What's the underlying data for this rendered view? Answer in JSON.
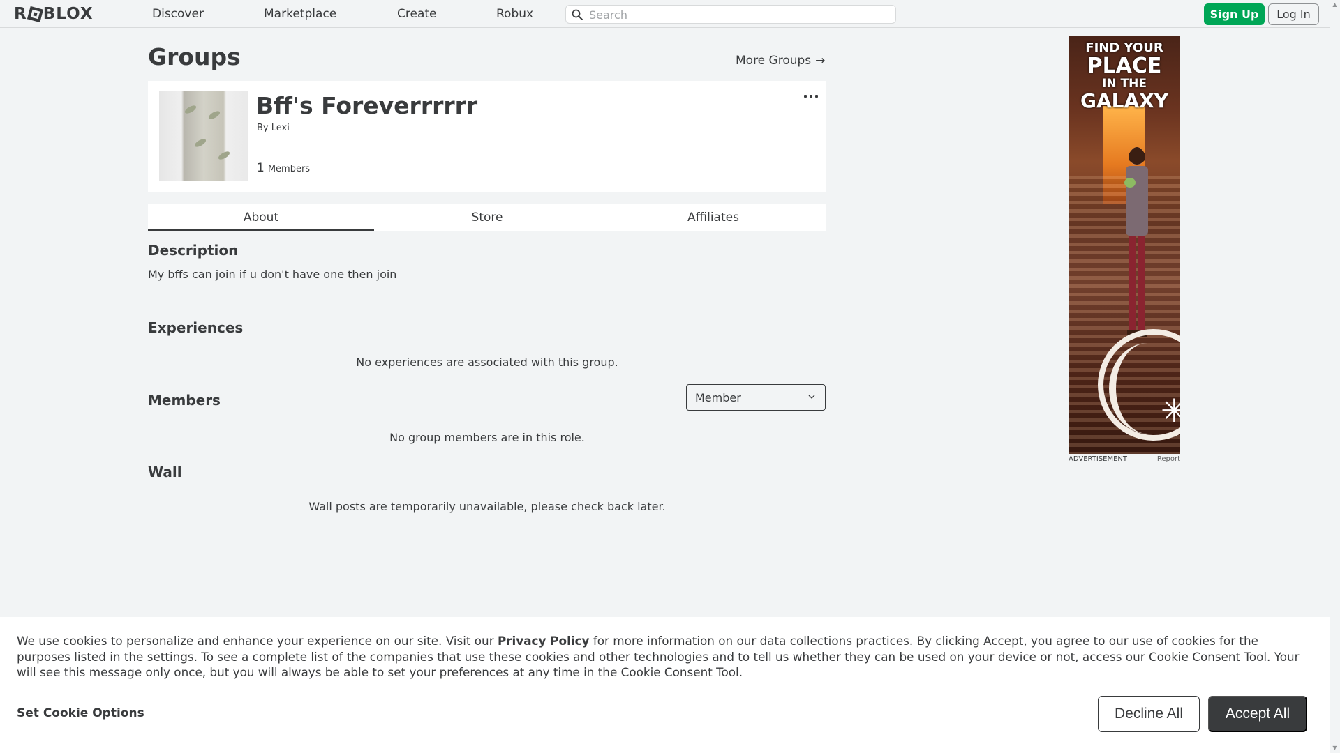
{
  "header": {
    "logo_text": "ROBLOX",
    "nav": [
      "Discover",
      "Marketplace",
      "Create",
      "Robux"
    ],
    "search_placeholder": "Search",
    "signup_label": "Sign Up",
    "login_label": "Log In"
  },
  "page": {
    "title": "Groups",
    "more_groups": "More Groups",
    "more_groups_icon": "arrow-right-icon"
  },
  "group": {
    "name": "Bff's Foreverrrrrr",
    "by_label": "By",
    "owner": "Lexi",
    "member_count": "1",
    "members_label": "Members",
    "more_icon": "ellipsis-icon"
  },
  "tabs": [
    {
      "label": "About",
      "active": true
    },
    {
      "label": "Store",
      "active": false
    },
    {
      "label": "Affiliates",
      "active": false
    }
  ],
  "about": {
    "description_heading": "Description",
    "description_text": "My bffs can join if u don't have one then join",
    "experiences_heading": "Experiences",
    "experiences_empty": "No experiences are associated with this group.",
    "members_heading": "Members",
    "role_select_value": "Member",
    "members_empty": "No group members are in this role.",
    "wall_heading": "Wall",
    "wall_empty": "Wall posts are temporarily unavailable, please check back later."
  },
  "ad": {
    "line1": "FIND YOUR",
    "line2": "PLACE",
    "line3": "IN THE",
    "line4": "GALAXY",
    "label": "ADVERTISEMENT",
    "report": "Report"
  },
  "cookie": {
    "text_before": "We use cookies to personalize and enhance your experience on our site. Visit our ",
    "policy_link": "Privacy Policy",
    "text_after": " for more information on our data collections practices. By clicking Accept, you agree to our use of cookies for the purposes listed in the settings. To see a complete list of the companies that use these cookies and other technologies and to tell us whether they can be used on your device or not, access our Cookie Consent Tool. Your will see this message only once, but you will always be able to set your preferences at any time in the Cookie Consent Tool.",
    "options_label": "Set Cookie Options",
    "decline_label": "Decline All",
    "accept_label": "Accept All"
  },
  "colors": {
    "signup_green": "#00a656",
    "accept_dark": "#393b3d",
    "page_bg": "#f2f4f5"
  }
}
